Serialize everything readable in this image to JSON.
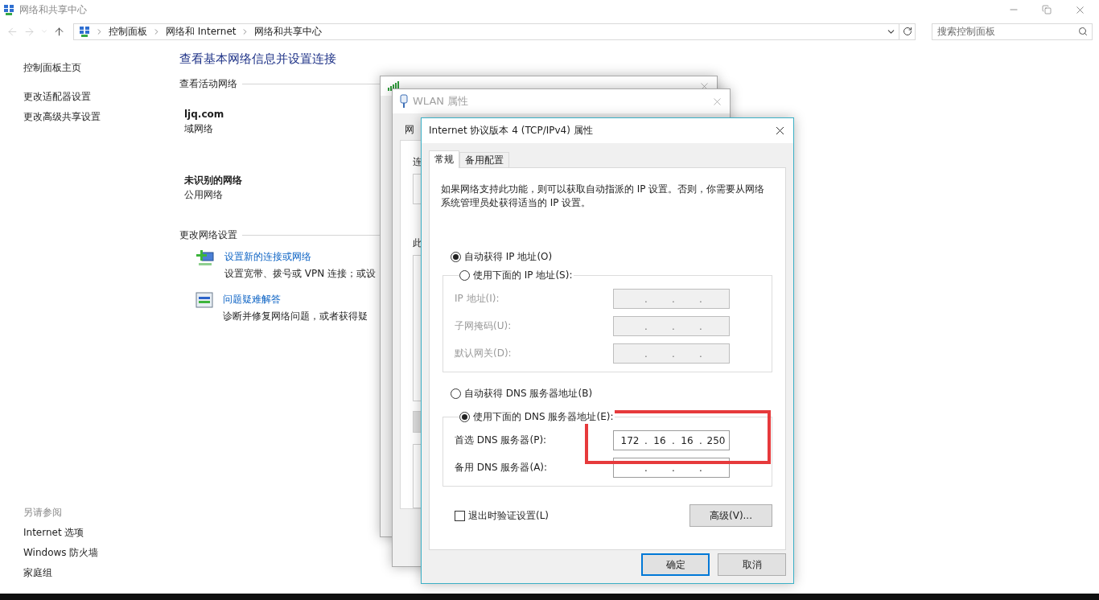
{
  "window": {
    "title": "网络和共享中心"
  },
  "address_bar": {
    "breadcrumbs": [
      "控制面板",
      "网络和 Internet",
      "网络和共享中心"
    ]
  },
  "search": {
    "placeholder": "搜索控制面板"
  },
  "sidebar": {
    "items": [
      "控制面板主页",
      "更改适配器设置",
      "更改高级共享设置"
    ],
    "see_also_title": "另请参阅",
    "see_also": [
      "Internet 选项",
      "Windows 防火墙",
      "家庭组"
    ]
  },
  "content": {
    "heading": "查看基本网络信息并设置连接",
    "active_networks": {
      "title": "查看活动网络",
      "networks": [
        {
          "name": "ljq.com",
          "type": "域网络"
        },
        {
          "name": "未识别的网络",
          "type": "公用网络"
        }
      ]
    },
    "change_settings": {
      "title": "更改网络设置",
      "tasks": [
        {
          "kind": "new-connection",
          "link": "设置新的连接或网络",
          "description": "设置宽带、拨号或 VPN 连接；或设"
        },
        {
          "kind": "troubleshoot",
          "link": "问题疑难解答",
          "description": "诊断并修复网络问题，或者获得疑"
        }
      ]
    }
  },
  "wlan_status": {
    "kind": "background-window"
  },
  "wlan_properties": {
    "title": "WLAN 属性",
    "tab": "网",
    "labels": [
      "连",
      "此"
    ]
  },
  "ipv4": {
    "title": "Internet 协议版本 4 (TCP/IPv4) 属性",
    "tabs": [
      {
        "label": "常规",
        "selected": true
      },
      {
        "label": "备用配置",
        "selected": false
      }
    ],
    "description": "如果网络支持此功能，则可以获取自动指派的 IP 设置。否则，你需要从网络系统管理员处获得适当的 IP 设置。",
    "ip_mode": [
      {
        "label": "自动获得 IP 地址(O)",
        "selected": true
      },
      {
        "label": "使用下面的 IP 地址(S):",
        "selected": false
      }
    ],
    "ip_fields": [
      {
        "label": "IP 地址(I):",
        "disabled": true,
        "separators": [
          ".",
          ".",
          "."
        ]
      },
      {
        "label": "子网掩码(U):",
        "disabled": true,
        "separators": [
          ".",
          ".",
          "."
        ]
      },
      {
        "label": "默认网关(D):",
        "disabled": true,
        "separators": [
          ".",
          ".",
          "."
        ]
      }
    ],
    "dns_mode": [
      {
        "label": "自动获得 DNS 服务器地址(B)",
        "selected": false
      },
      {
        "label": "使用下面的 DNS 服务器地址(E):",
        "selected": true
      }
    ],
    "dns_fields": [
      {
        "label": "首选 DNS 服务器(P):",
        "disabled": false,
        "octets": [
          "172",
          "16",
          "16",
          "250"
        ],
        "separators": [
          ".",
          ".",
          "."
        ]
      },
      {
        "label": "备用 DNS 服务器(A):",
        "disabled": false,
        "separators": [
          ".",
          ".",
          "."
        ]
      }
    ],
    "validate": {
      "label": "退出时验证设置(L)",
      "checked": false
    },
    "advanced_button": "高级(V)...",
    "buttons": [
      {
        "label": "确定",
        "default": true
      },
      {
        "label": "取消",
        "default": false
      }
    ]
  }
}
